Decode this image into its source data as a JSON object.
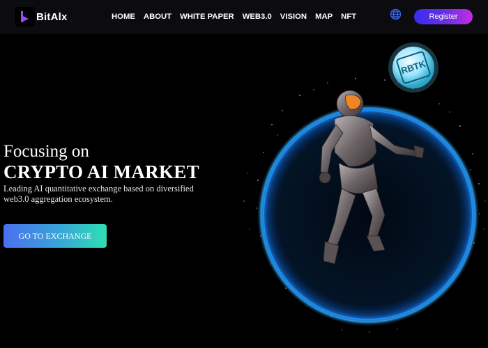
{
  "brand": {
    "name": "BitAlx",
    "logo_icon": "b-logo-icon"
  },
  "nav": {
    "items": [
      {
        "label": "HOME"
      },
      {
        "label": "ABOUT"
      },
      {
        "label": "WHITE PAPER"
      },
      {
        "label": "WEB3.0"
      },
      {
        "label": "VISION"
      },
      {
        "label": "MAP"
      },
      {
        "label": "NFT"
      }
    ]
  },
  "header": {
    "globe_icon": "globe-icon",
    "register_label": "Register"
  },
  "hero": {
    "title_line1": "Focusing on",
    "title_line2": "CRYPTO AI MARKET",
    "subtitle": "Leading AI quantitative exchange based on diversified web3.0 aggregation ecosystem.",
    "cta_label": "GO TO EXCHANGE",
    "badge_text": "RBTK"
  },
  "colors": {
    "background": "#000000",
    "header_bg": "#0c0c10",
    "register_gradient": [
      "#3a2cf0",
      "#c42ee0"
    ],
    "cta_gradient": [
      "#4a6ff0",
      "#2ee0b4"
    ],
    "ring": "#1e8fff"
  }
}
